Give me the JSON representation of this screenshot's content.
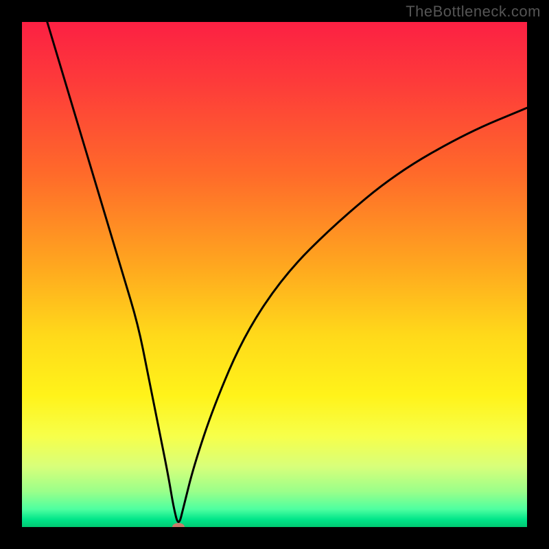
{
  "watermark": "TheBottleneck.com",
  "chart_data": {
    "type": "line",
    "title": "",
    "xlabel": "",
    "ylabel": "",
    "xlim": [
      0,
      100
    ],
    "ylim": [
      0,
      100
    ],
    "grid": false,
    "legend": false,
    "curve_points": [
      {
        "x": 5,
        "y": 100
      },
      {
        "x": 8,
        "y": 90
      },
      {
        "x": 11,
        "y": 80
      },
      {
        "x": 14,
        "y": 70
      },
      {
        "x": 17,
        "y": 60
      },
      {
        "x": 20,
        "y": 50
      },
      {
        "x": 23,
        "y": 40
      },
      {
        "x": 25,
        "y": 30
      },
      {
        "x": 27,
        "y": 20
      },
      {
        "x": 29,
        "y": 10
      },
      {
        "x": 30,
        "y": 4
      },
      {
        "x": 31,
        "y": 0
      },
      {
        "x": 32,
        "y": 4
      },
      {
        "x": 34,
        "y": 12
      },
      {
        "x": 38,
        "y": 24
      },
      {
        "x": 44,
        "y": 38
      },
      {
        "x": 52,
        "y": 50
      },
      {
        "x": 62,
        "y": 60
      },
      {
        "x": 74,
        "y": 70
      },
      {
        "x": 88,
        "y": 78
      },
      {
        "x": 100,
        "y": 83
      }
    ],
    "minimum_marker": {
      "x": 31,
      "y": 0,
      "color": "#c97b6b"
    },
    "background_gradient": {
      "top": "#fc2043",
      "bottom": "#00c872",
      "description": "red-to-green vertical gradient (high bottleneck to low)"
    }
  }
}
